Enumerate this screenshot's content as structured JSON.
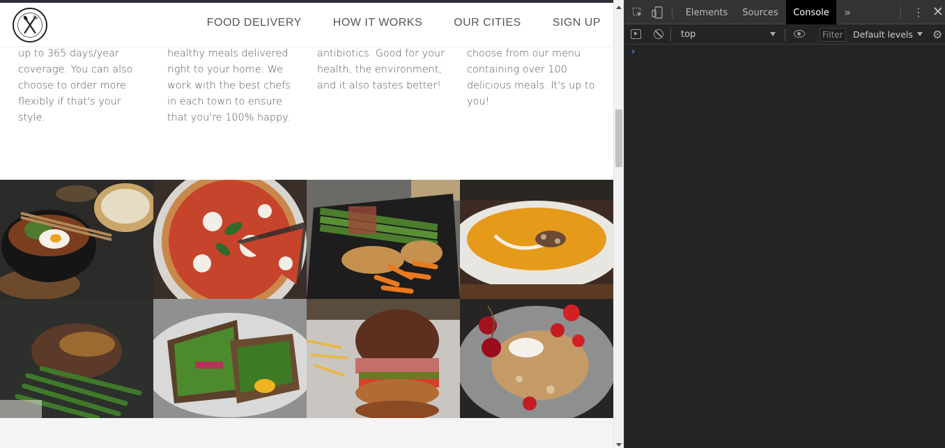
{
  "site": {
    "nav": {
      "logo_name": "omnifood-logo",
      "links": [
        "FOOD DELIVERY",
        "HOW IT WORKS",
        "OUR CITIES",
        "SIGN UP"
      ]
    },
    "features": [
      {
        "lines": [
          "up to 365 days/year",
          "coverage. You can also",
          "choose to order more",
          "flexibly if that's your style."
        ]
      },
      {
        "lines": [
          "healthy meals delivered",
          "right to your home. We",
          "work with the best chefs",
          "in each town to ensure",
          "that you're 100% happy."
        ]
      },
      {
        "lines": [
          "antibiotics. Good for your",
          "health, the environment,",
          "and it also tastes better!"
        ]
      },
      {
        "lines": [
          "choose from our menu",
          "containing over 100",
          "delicious meals. It's up to",
          "you!"
        ]
      }
    ],
    "gallery": [
      {
        "name": "bibimbap-photo",
        "icon": "bibimbap"
      },
      {
        "name": "pizza-photo",
        "icon": "pizza"
      },
      {
        "name": "asparagus-chicken-photo",
        "icon": "asparagus-chicken"
      },
      {
        "name": "pumpkin-soup-photo",
        "icon": "pumpkin-soup"
      },
      {
        "name": "steak-beans-photo",
        "icon": "steak-beans"
      },
      {
        "name": "sandwich-photo",
        "icon": "sandwich"
      },
      {
        "name": "burger-photo",
        "icon": "burger"
      },
      {
        "name": "granola-cherries-photo",
        "icon": "granola-cherries"
      }
    ]
  },
  "devtools": {
    "tabs": [
      "Elements",
      "Sources",
      "Console"
    ],
    "active_tab": "Console",
    "toolbar": {
      "context": "top",
      "filter_placeholder": "Filter",
      "levels": "Default levels"
    },
    "console": {
      "prompt": "›",
      "input_value": ""
    },
    "colors": {
      "accent": "#4d8bff",
      "panel_bg": "#242424",
      "tabbar_bg": "#333333"
    }
  }
}
